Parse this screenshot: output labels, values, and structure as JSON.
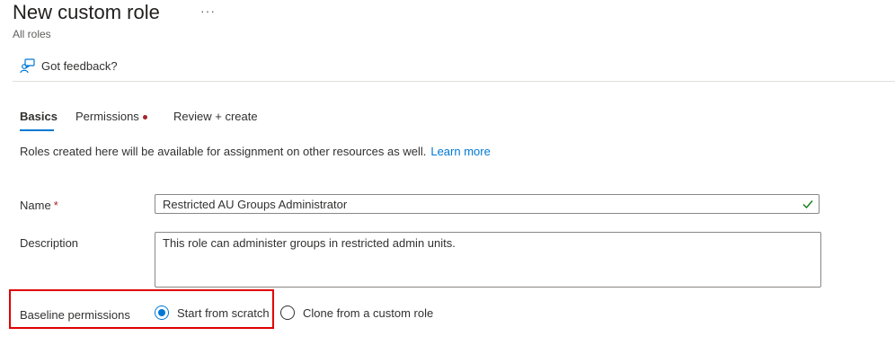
{
  "header": {
    "title": "New custom role",
    "more_label": "···",
    "breadcrumb": "All roles"
  },
  "toolbar": {
    "feedback_label": "Got feedback?",
    "feedback_icon": "feedback-person-icon"
  },
  "tabs": [
    {
      "label": "Basics",
      "selected": true
    },
    {
      "label": "Permissions",
      "has_error_dot": true
    },
    {
      "label": "Review + create"
    }
  ],
  "info": {
    "text": "Roles created here will be available for assignment on other resources as well.",
    "link": "Learn more"
  },
  "form": {
    "name": {
      "label": "Name",
      "required_mark": "*",
      "value": "Restricted AU Groups Administrator",
      "valid_icon": "checkmark-icon"
    },
    "description": {
      "label": "Description",
      "value": "This role can administer groups in restricted admin units."
    },
    "baseline": {
      "label": "Baseline permissions",
      "options": [
        {
          "label": "Start from scratch",
          "selected": true
        },
        {
          "label": "Clone from a custom role",
          "selected": false
        }
      ]
    }
  },
  "colors": {
    "accent": "#0078d4",
    "required": "#a4262c",
    "highlight": "#e00000",
    "valid": "#107c10"
  }
}
